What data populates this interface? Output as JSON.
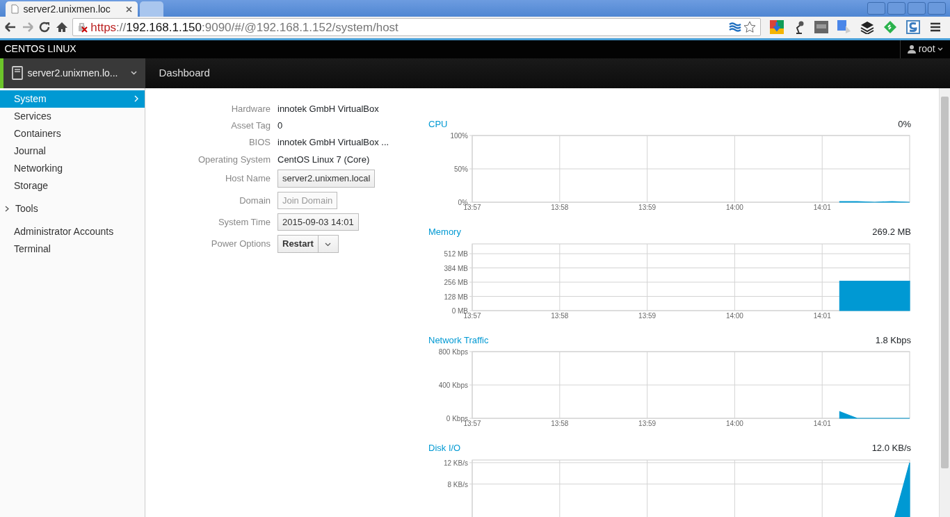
{
  "browser": {
    "tabs": [
      {
        "title": "server2.unixmen.loc",
        "selected": true
      },
      {
        "selected": false
      }
    ],
    "address": [
      {
        "text": "https",
        "kind": "insecure"
      },
      {
        "text": "://",
        "kind": "muted"
      },
      {
        "text": "192.168.1.150",
        "kind": "host"
      },
      {
        "text": ":9090/#/@192.168.1.152/system/host",
        "kind": "muted"
      }
    ]
  },
  "top_bar": {
    "brand": "CENTOS LINUX",
    "user": "root"
  },
  "host_bar": {
    "host": "server2.unixmen.lo...",
    "page": "Dashboard"
  },
  "sidebar": {
    "items": [
      {
        "label": "System",
        "kind": "link",
        "selected": true
      },
      {
        "label": "Services",
        "kind": "link",
        "selected": false
      },
      {
        "label": "Containers",
        "kind": "link",
        "selected": false
      },
      {
        "label": "Journal",
        "kind": "link",
        "selected": false
      },
      {
        "label": "Networking",
        "kind": "link",
        "selected": false
      },
      {
        "label": "Storage",
        "kind": "link",
        "selected": false
      },
      {
        "label": "Tools",
        "kind": "group",
        "selected": false,
        "expanded": false
      },
      {
        "label": "Administrator Accounts",
        "kind": "link",
        "selected": false
      },
      {
        "label": "Terminal",
        "kind": "link",
        "selected": false
      }
    ]
  },
  "info": [
    {
      "label": "Hardware",
      "value": "innotek GmbH VirtualBox",
      "kind": "text"
    },
    {
      "label": "Asset Tag",
      "value": "0",
      "kind": "text"
    },
    {
      "label": "BIOS",
      "value": "innotek GmbH VirtualBox ...",
      "kind": "text"
    },
    {
      "label": "Operating System",
      "value": "CentOS Linux 7 (Core)",
      "kind": "text"
    },
    {
      "label": "Host Name",
      "value": "server2.unixmen.local",
      "kind": "button",
      "disabled": false
    },
    {
      "label": "Domain",
      "value": "Join Domain",
      "kind": "button",
      "disabled": true
    },
    {
      "label": "System Time",
      "value": "2015-09-03 14:01",
      "kind": "button",
      "disabled": false
    },
    {
      "label": "Power Options",
      "value": "Restart",
      "kind": "split",
      "disabled": false
    }
  ],
  "graphs": [
    {
      "reading": "0%",
      "chart_data": {
        "type": "area",
        "title": "CPU",
        "grid": true,
        "ylim": [
          0,
          100
        ],
        "categories": [
          "13:57",
          null,
          null,
          null,
          null,
          "13:58",
          null,
          null,
          null,
          null,
          "13:59",
          null,
          null,
          null,
          null,
          "14:00",
          null,
          null,
          null,
          null,
          "14:01",
          null,
          null,
          null,
          null,
          null
        ],
        "yticks": [
          {
            "value": 0,
            "label": "0%"
          },
          {
            "value": 50,
            "label": "50%"
          },
          {
            "value": 100,
            "label": "100%"
          }
        ],
        "series": [
          {
            "color": "#0099d3",
            "values": [
              null,
              null,
              null,
              null,
              null,
              null,
              null,
              null,
              null,
              null,
              null,
              null,
              null,
              null,
              null,
              null,
              null,
              null,
              null,
              null,
              null,
              1,
              1,
              0,
              1,
              0
            ]
          }
        ]
      }
    },
    {
      "reading": "269.2 MB",
      "chart_data": {
        "type": "area",
        "title": "Memory",
        "grid": true,
        "ylim": [
          0,
          600
        ],
        "categories": [
          "13:57",
          null,
          null,
          null,
          null,
          "13:58",
          null,
          null,
          null,
          null,
          "13:59",
          null,
          null,
          null,
          null,
          "14:00",
          null,
          null,
          null,
          null,
          "14:01",
          null,
          null,
          null,
          null,
          null
        ],
        "yticks": [
          {
            "value": 0,
            "label": "0 MB"
          },
          {
            "value": 128,
            "label": "128 MB"
          },
          {
            "value": 256,
            "label": "256 MB"
          },
          {
            "value": 384,
            "label": "384 MB"
          },
          {
            "value": 512,
            "label": "512 MB"
          }
        ],
        "series": [
          {
            "color": "#0099d3",
            "values": [
              null,
              null,
              null,
              null,
              null,
              null,
              null,
              null,
              null,
              null,
              null,
              null,
              null,
              null,
              null,
              null,
              null,
              null,
              null,
              null,
              null,
              265,
              265,
              265,
              265,
              265
            ]
          }
        ]
      }
    },
    {
      "reading": "1.8 Kbps",
      "chart_data": {
        "type": "area",
        "title": "Network Traffic",
        "grid": true,
        "ylim": [
          0,
          800
        ],
        "categories": [
          "13:57",
          null,
          null,
          null,
          null,
          "13:58",
          null,
          null,
          null,
          null,
          "13:59",
          null,
          null,
          null,
          null,
          "14:00",
          null,
          null,
          null,
          null,
          "14:01",
          null,
          null,
          null,
          null,
          null
        ],
        "yticks": [
          {
            "value": 0,
            "label": "0 Kbps"
          },
          {
            "value": 400,
            "label": "400 Kbps"
          },
          {
            "value": 800,
            "label": "800 Kbps"
          }
        ],
        "series": [
          {
            "color": "#0099d3",
            "values": [
              null,
              null,
              null,
              null,
              null,
              null,
              null,
              null,
              null,
              null,
              null,
              null,
              null,
              null,
              null,
              null,
              null,
              null,
              null,
              null,
              null,
              80,
              0,
              0,
              0,
              0
            ]
          }
        ]
      }
    },
    {
      "reading": "12.0 KB/s",
      "chart_data": {
        "type": "area",
        "title": "Disk I/O",
        "grid": true,
        "ylim": [
          0,
          12.5
        ],
        "categories": [
          null,
          null,
          null,
          null,
          null,
          null,
          null,
          null,
          null,
          null,
          null,
          null,
          null,
          null,
          null,
          null,
          null,
          null,
          null,
          null,
          null,
          null,
          null,
          null,
          null,
          null
        ],
        "yticks": [
          {
            "value": 8,
            "label": "8 KB/s"
          },
          {
            "value": 12,
            "label": "12 KB/s"
          }
        ],
        "series": [
          {
            "color": "#0099d3",
            "values": [
              null,
              null,
              null,
              null,
              null,
              null,
              null,
              null,
              null,
              null,
              null,
              null,
              null,
              null,
              null,
              null,
              null,
              null,
              null,
              null,
              null,
              0,
              0,
              0,
              0,
              12
            ]
          }
        ]
      }
    }
  ]
}
